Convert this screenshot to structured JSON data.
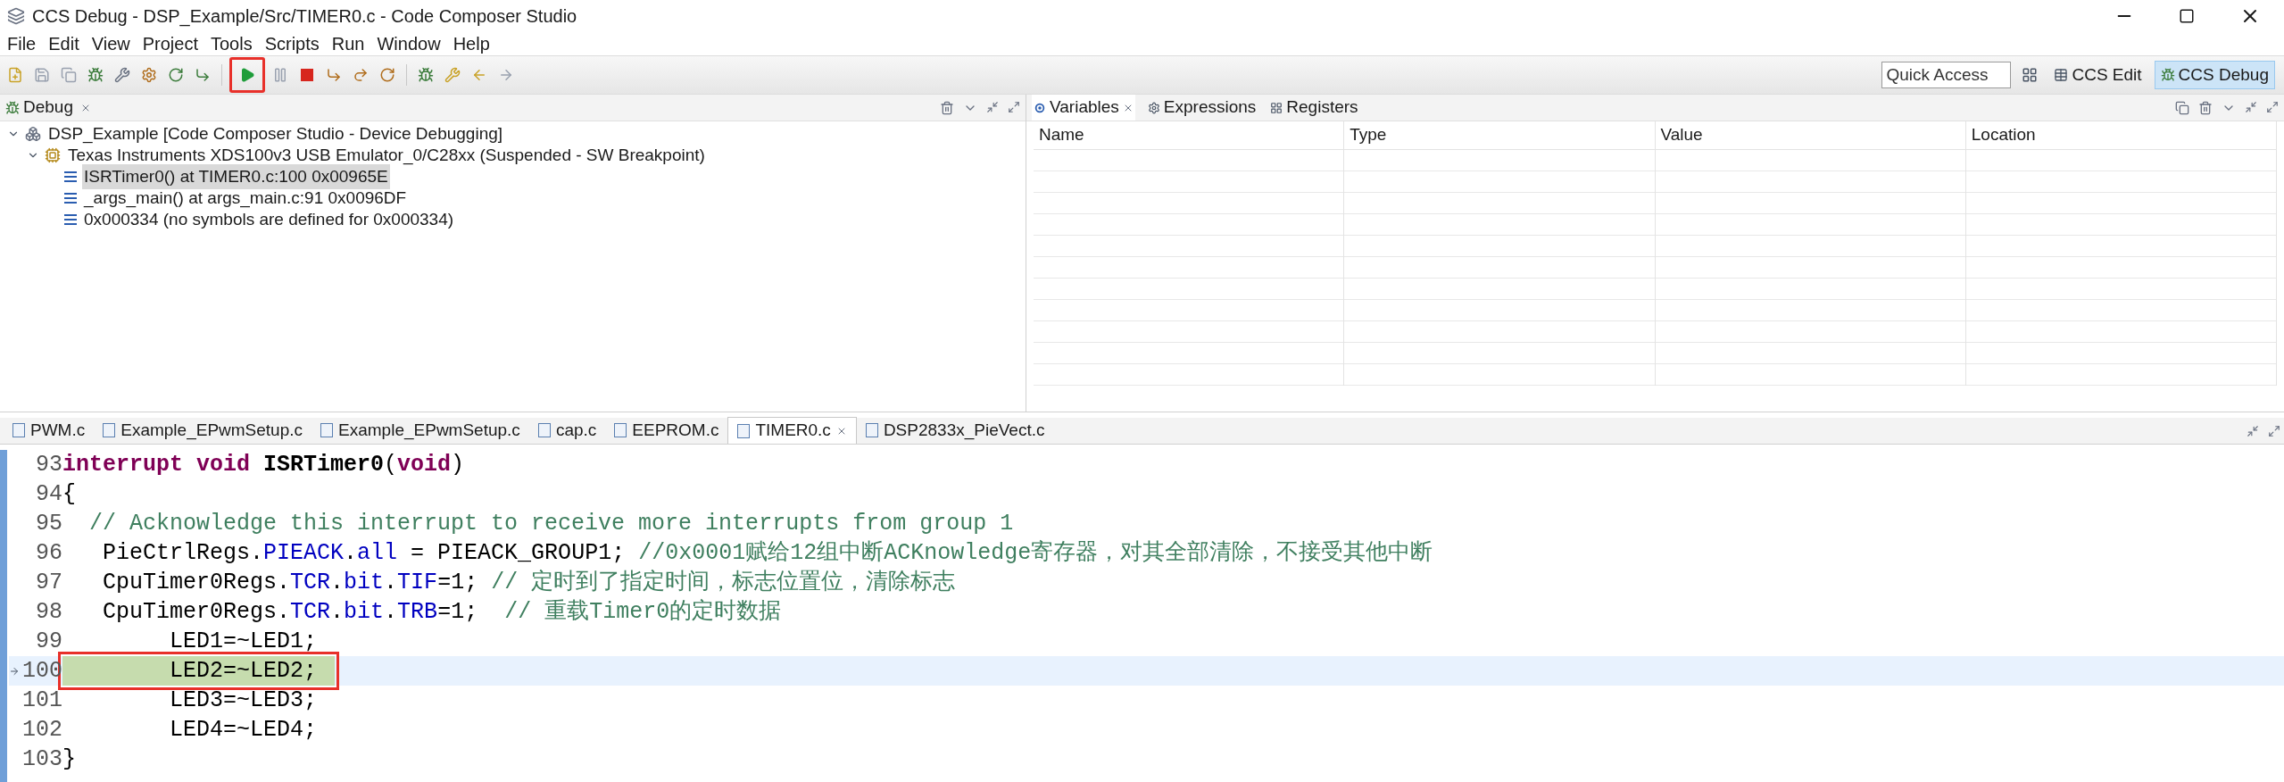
{
  "window": {
    "title": "CCS Debug - DSP_Example/Src/TIMER0.c - Code Composer Studio"
  },
  "menu": [
    "File",
    "Edit",
    "View",
    "Project",
    "Tools",
    "Scripts",
    "Run",
    "Window",
    "Help"
  ],
  "toolbar": {
    "resume_marked": true,
    "quick_access": {
      "placeholder": "Quick Access"
    },
    "perspectives": [
      {
        "label": "CCS Edit",
        "selected": false
      },
      {
        "label": "CCS Debug",
        "selected": true
      }
    ]
  },
  "debug_view": {
    "tab": "Debug",
    "tree": [
      {
        "label": "DSP_Example [Code Composer Studio - Device Debugging]",
        "kind": "project",
        "expanded": true,
        "children": [
          {
            "label": "Texas Instruments XDS100v3 USB Emulator_0/C28xx (Suspended - SW Breakpoint)",
            "kind": "target",
            "expanded": true,
            "children": [
              {
                "label": "ISRTimer0() at TIMER0.c:100 0x00965E",
                "kind": "frame",
                "selected": true
              },
              {
                "label": "_args_main() at args_main.c:91 0x0096DF",
                "kind": "frame",
                "selected": false
              },
              {
                "label": "0x000334  (no symbols are defined for 0x000334)",
                "kind": "frame",
                "selected": false
              }
            ]
          }
        ]
      }
    ]
  },
  "variables_view": {
    "tabs": [
      {
        "label": "Variables",
        "selected": true
      },
      {
        "label": "Expressions",
        "selected": false
      },
      {
        "label": "Registers",
        "selected": false
      }
    ],
    "columns": [
      "Name",
      "Type",
      "Value",
      "Location"
    ]
  },
  "editor": {
    "tabs": [
      {
        "label": "PWM.c",
        "selected": false
      },
      {
        "label": "Example_EPwmSetup.c",
        "selected": false
      },
      {
        "label": "Example_EPwmSetup.c",
        "selected": false
      },
      {
        "label": "cap.c",
        "selected": false
      },
      {
        "label": "EEPROM.c",
        "selected": false
      },
      {
        "label": "TIMER0.c",
        "selected": true
      },
      {
        "label": "DSP2833x_PieVect.c",
        "selected": false
      }
    ],
    "lines": [
      {
        "number": "93",
        "current": false,
        "marked": false,
        "segments": [
          {
            "kind": "keyword",
            "text": "interrupt void "
          },
          {
            "kind": "bold",
            "text": "ISRTimer0"
          },
          {
            "kind": "plain",
            "text": "("
          },
          {
            "kind": "keyword",
            "text": "void"
          },
          {
            "kind": "plain",
            "text": ")"
          }
        ]
      },
      {
        "number": "94",
        "current": false,
        "marked": false,
        "segments": [
          {
            "kind": "plain",
            "text": "{"
          }
        ]
      },
      {
        "number": "95",
        "current": false,
        "marked": false,
        "segments": [
          {
            "kind": "comment",
            "text": "  // Acknowledge this interrupt to receive more interrupts from group 1"
          }
        ]
      },
      {
        "number": "96",
        "current": false,
        "marked": false,
        "segments": [
          {
            "kind": "plain",
            "text": "   PieCtrlRegs."
          },
          {
            "kind": "field",
            "text": "PIEACK"
          },
          {
            "kind": "plain",
            "text": "."
          },
          {
            "kind": "field",
            "text": "all"
          },
          {
            "kind": "plain",
            "text": " = PIEACK_GROUP1; "
          },
          {
            "kind": "comment",
            "text": "//0x0001赋给12组中断ACKnowledge寄存器，对其全部清除，不接受其他中断"
          }
        ]
      },
      {
        "number": "97",
        "current": false,
        "marked": false,
        "segments": [
          {
            "kind": "plain",
            "text": "   CpuTimer0Regs."
          },
          {
            "kind": "field",
            "text": "TCR"
          },
          {
            "kind": "plain",
            "text": "."
          },
          {
            "kind": "field",
            "text": "bit"
          },
          {
            "kind": "plain",
            "text": "."
          },
          {
            "kind": "field",
            "text": "TIF"
          },
          {
            "kind": "plain",
            "text": "=1; "
          },
          {
            "kind": "comment",
            "text": "// 定时到了指定时间，标志位置位，清除标志"
          }
        ]
      },
      {
        "number": "98",
        "current": false,
        "marked": false,
        "segments": [
          {
            "kind": "plain",
            "text": "   CpuTimer0Regs."
          },
          {
            "kind": "field",
            "text": "TCR"
          },
          {
            "kind": "plain",
            "text": "."
          },
          {
            "kind": "field",
            "text": "bit"
          },
          {
            "kind": "plain",
            "text": "."
          },
          {
            "kind": "field",
            "text": "TRB"
          },
          {
            "kind": "plain",
            "text": "=1;  "
          },
          {
            "kind": "comment",
            "text": "// 重载Timer0的定时数据"
          }
        ]
      },
      {
        "number": "99",
        "current": false,
        "marked": false,
        "segments": [
          {
            "kind": "plain",
            "text": "        LED1=~LED1;"
          }
        ]
      },
      {
        "number": "100",
        "current": true,
        "marked": true,
        "segments": [
          {
            "kind": "plain",
            "text": "        LED2=~LED2;"
          }
        ]
      },
      {
        "number": "101",
        "current": false,
        "marked": false,
        "segments": [
          {
            "kind": "plain",
            "text": "        LED3=~LED3;"
          }
        ]
      },
      {
        "number": "102",
        "current": false,
        "marked": false,
        "segments": [
          {
            "kind": "plain",
            "text": "        LED4=~LED4;"
          }
        ]
      },
      {
        "number": "103",
        "current": false,
        "marked": false,
        "segments": [
          {
            "kind": "plain",
            "text": "}"
          }
        ]
      }
    ]
  }
}
